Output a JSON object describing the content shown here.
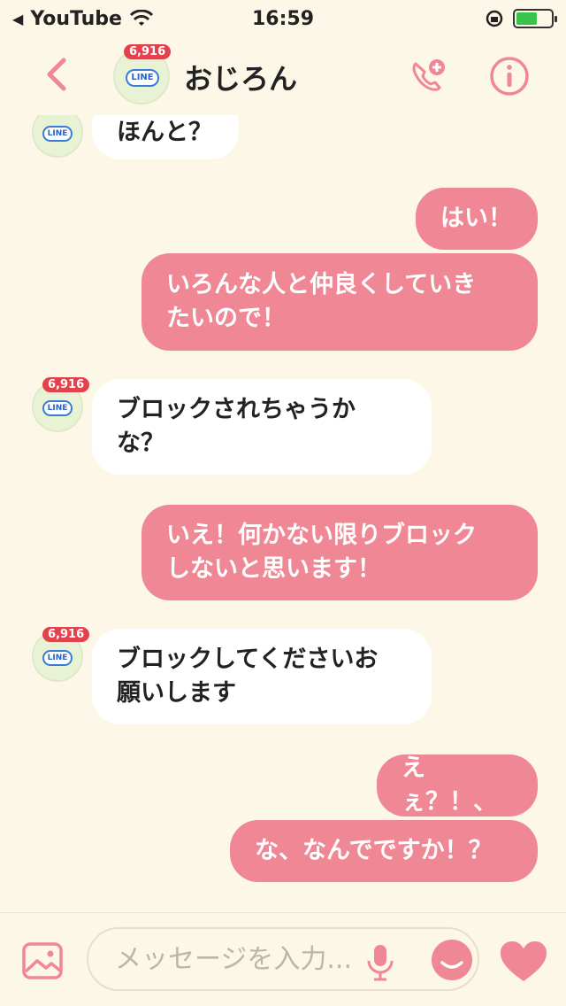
{
  "status_bar": {
    "back_app": "YouTube",
    "time": "16:59"
  },
  "header": {
    "title": "おじろん",
    "avatar_badge": "6,916",
    "avatar_logo": "LINE"
  },
  "messages": [
    {
      "side": "in",
      "lines": [
        "ほんと？"
      ]
    },
    {
      "side": "out",
      "lines": [
        "はい！"
      ]
    },
    {
      "side": "out",
      "lines": [
        "いろんな人と仲良くしていき",
        "たいので！"
      ]
    },
    {
      "side": "in",
      "lines": [
        "ブロックされちゃうか",
        "な？"
      ]
    },
    {
      "side": "out",
      "lines": [
        "いえ！何かない限りブロック",
        "しないと思います！"
      ]
    },
    {
      "side": "in",
      "lines": [
        "ブロックしてくださいお",
        "願いします"
      ]
    },
    {
      "side": "out",
      "lines": [
        "えぇ？！、"
      ]
    },
    {
      "side": "out",
      "lines": [
        "な、なんでですか！？"
      ]
    }
  ],
  "input": {
    "placeholder": "メッセージを入力..."
  },
  "colors": {
    "accent": "#ef8794",
    "background": "#fdf7e8",
    "incoming_bubble": "#ffffff"
  }
}
